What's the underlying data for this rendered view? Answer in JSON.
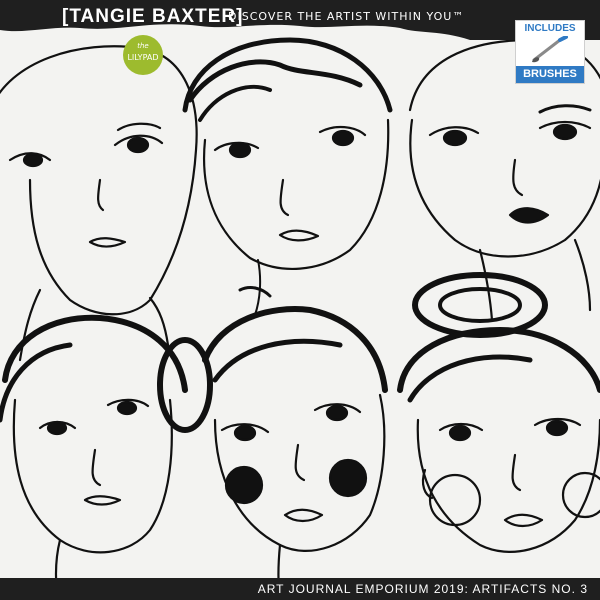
{
  "header": {
    "brand": "[TANGIE BAXTER]",
    "tagline": "DISCOVER THE ARTIST WITHIN YOU™"
  },
  "lilypad_badge": {
    "small": "the",
    "name": "LILYPAD",
    "color": "#9dbb2e"
  },
  "includes_badge": {
    "top": "INCLUDES",
    "bottom": "BRUSHES",
    "icon": "paintbrush-icon",
    "color": "#2f7ac4"
  },
  "footer": {
    "title": "ART JOURNAL EMPORIUM 2019: ARTIFACTS NO. 3"
  }
}
